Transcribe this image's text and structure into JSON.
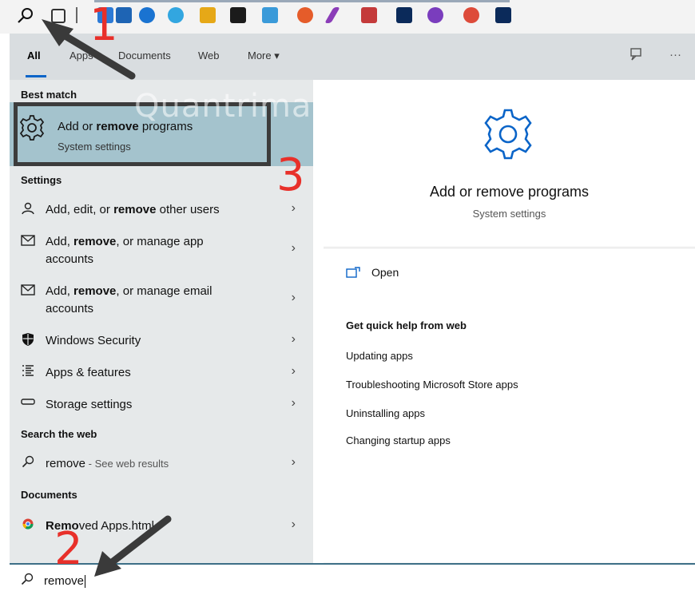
{
  "taskbar": {
    "icons": [
      "search-icon",
      "task-view-icon",
      "file-explorer-icon",
      "store-icon",
      "edge-icon",
      "ie-icon",
      "folder-icon",
      "bag-icon",
      "network-icon",
      "chrome-icon",
      "pen-icon",
      "shield-icon",
      "photoshop-icon",
      "viber-icon",
      "chrome-icon",
      "photoshop-icon"
    ]
  },
  "tabs": {
    "all": "All",
    "apps": "Apps",
    "documents": "Documents",
    "web": "Web",
    "more": "More ▾",
    "feedback_icon": "feedback-icon",
    "more_options": "···"
  },
  "left": {
    "best_match_heading": "Best match",
    "best_match": {
      "title_prefix": "Add or ",
      "title_bold": "remove",
      "title_suffix": " programs",
      "subtitle": "System settings"
    },
    "settings_heading": "Settings",
    "settings": [
      {
        "icon": "person-icon",
        "pre": "Add, edit, or ",
        "bold": "remove",
        "post": " other users"
      },
      {
        "icon": "mail-icon",
        "pre": "Add, ",
        "bold": "remove",
        "post": ", or manage app",
        "line2": "accounts"
      },
      {
        "icon": "mail-icon",
        "pre": "Add, ",
        "bold": "remove",
        "post": ", or manage email",
        "line2": "accounts"
      },
      {
        "icon": "shield-icon",
        "pre": "Windows Security",
        "bold": "",
        "post": ""
      },
      {
        "icon": "list-icon",
        "pre": "Apps & features",
        "bold": "",
        "post": ""
      },
      {
        "icon": "storage-icon",
        "pre": "Storage settings",
        "bold": "",
        "post": ""
      }
    ],
    "web_heading": "Search the web",
    "web_result": {
      "term": "remove",
      "suffix": " - See web results"
    },
    "documents_heading": "Documents",
    "document": {
      "pre": "Re",
      "hidden": "mo",
      "post": "ved Apps.ht",
      "tail": "ml"
    }
  },
  "right": {
    "title": "Add or remove programs",
    "subtitle": "System settings",
    "open_label": "Open",
    "help_heading": "Get quick help from web",
    "help_links": [
      "Updating apps",
      "Troubleshooting Microsoft Store apps",
      "Uninstalling apps",
      "Changing startup apps"
    ]
  },
  "search": {
    "value": "remove"
  },
  "annotations": {
    "step1": "1",
    "step2": "2",
    "step3": "3",
    "watermark": "Quantrimang"
  },
  "colors": {
    "accent": "#0a64c8",
    "highlight": "#a4c3cd",
    "annotation": "#e8302a"
  }
}
